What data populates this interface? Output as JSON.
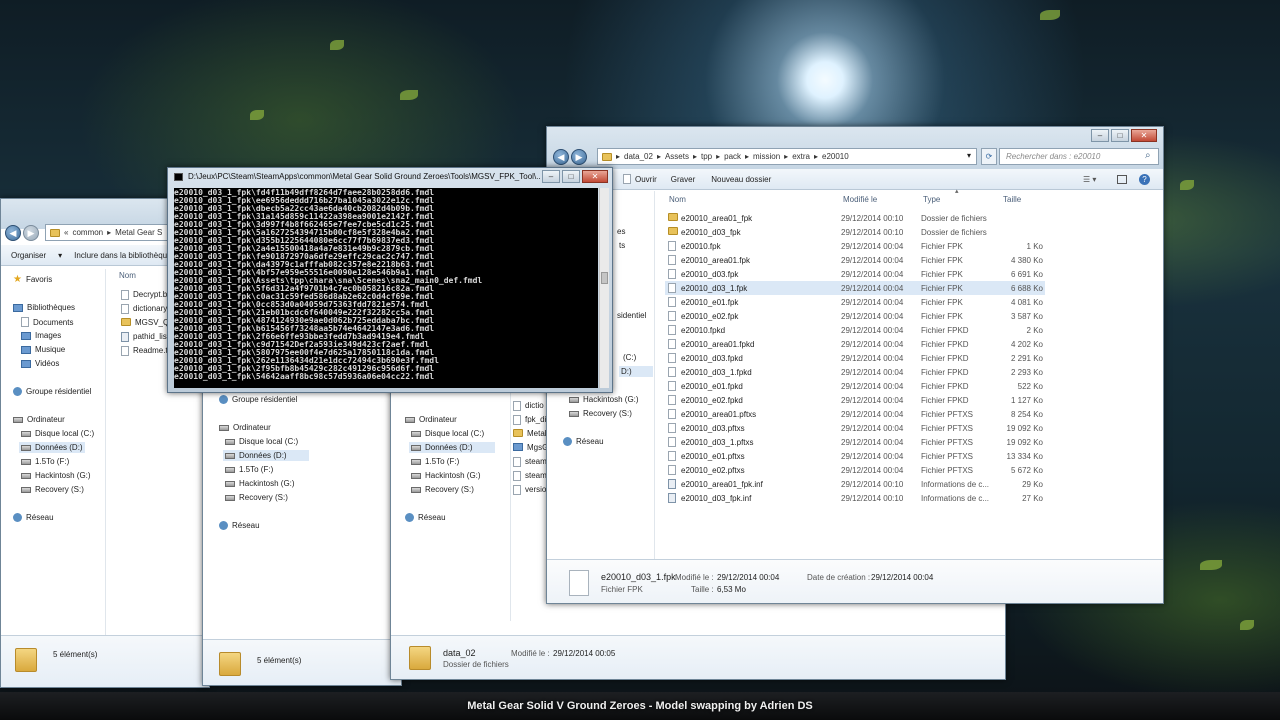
{
  "video_caption": "Metal Gear Solid V Ground Zeroes - Model swapping by Adrien DS",
  "window_back": {
    "address": [
      "common",
      "Metal Gear S"
    ],
    "cmd": {
      "organize": "Organiser",
      "include": "Inclure dans la bibliothèque"
    },
    "sidebar": [
      {
        "label": "Favoris",
        "icon": "star-icon"
      },
      {
        "label": "Bibliothèques",
        "icon": "library-icon"
      },
      {
        "label": "Documents",
        "icon": "documents-icon"
      },
      {
        "label": "Images",
        "icon": "images-icon"
      },
      {
        "label": "Musique",
        "icon": "music-icon"
      },
      {
        "label": "Vidéos",
        "icon": "videos-icon"
      },
      {
        "label": "Groupe résidentiel",
        "icon": "homegroup-icon"
      },
      {
        "label": "Ordinateur",
        "icon": "computer-icon"
      },
      {
        "label": "Disque local (C:)",
        "icon": "drive-icon"
      },
      {
        "label": "Données (D:)",
        "icon": "drive-icon"
      },
      {
        "label": "1.5To (F:)",
        "icon": "drive-icon"
      },
      {
        "label": "Hackintosh (G:)",
        "icon": "drive-icon"
      },
      {
        "label": "Recovery (S:)",
        "icon": "drive-icon"
      },
      {
        "label": "Réseau",
        "icon": "network-icon"
      }
    ],
    "col_name": "Nom",
    "files": [
      "Decrypt.b",
      "dictionary",
      "MGSV_QA",
      "pathid_list",
      "Readme.t"
    ],
    "status": "5 élément(s)"
  },
  "window_mid": {
    "sidebar": [
      {
        "label": "Groupe résidentiel"
      },
      {
        "label": "Ordinateur"
      },
      {
        "label": "Disque local (C:)"
      },
      {
        "label": "Données (D:)"
      },
      {
        "label": "1.5To (F:)"
      },
      {
        "label": "Hackintosh (G:)"
      },
      {
        "label": "Recovery (S:)"
      },
      {
        "label": "Réseau"
      }
    ],
    "status": "5 élément(s)"
  },
  "window_mid2": {
    "sidebar": [
      {
        "label": "Ordinateur"
      },
      {
        "label": "Disque local (C:)"
      },
      {
        "label": "Données (D:)"
      },
      {
        "label": "1.5To (F:)"
      },
      {
        "label": "Hackintosh (G:)"
      },
      {
        "label": "Recovery (S:)"
      },
      {
        "label": "Réseau"
      }
    ],
    "files": [
      "dictio",
      "fpk_di",
      "Metal",
      "MgsG",
      "steam",
      "steam",
      "versio"
    ],
    "details": {
      "name": "data_02",
      "modified_label": "Modifié le :",
      "modified": "29/12/2014 00:05",
      "type": "Dossier de fichiers"
    }
  },
  "console": {
    "title": "D:\\Jeux\\PC\\Steam\\SteamApps\\common\\Metal Gear Solid Ground Zeroes\\Tools\\MGSV_FPK_Tool\\...",
    "lines": [
      "e20010_d03_1_fpk\\fd4f11b49dff8264d7faee28b0258dd6.fmdl",
      "e20010_d03_1_fpk\\ee6956deddd716b27ba1045a3022e12c.fmdl",
      "e20010_d03_1_fpk\\dbecb5a22cc43ae6da40cb2082d4b09b.fmdl",
      "e20010_d03_1_fpk\\31a145d859c11422a398ea9001e2142f.fmdl",
      "e20010_d03_1_fpk\\3d997f4b8f662465e7fee7cbe5cd1c25.fmdl",
      "e20010_d03_1_fpk\\5a1627254394715b00cf8e5f328e4ba2.fmdl",
      "e20010_d03_1_fpk\\d355b1225644080e6cc77f7b69837ed3.fmdl",
      "e20010_d03_1_fpk\\2a4e15500418a4a7e831e49b9c2879cb.fmdl",
      "e20010_d03_1_fpk\\fe901872970a6dfe29effc29cac2c747.fmdl",
      "e20010_d03_1_fpk\\da43979c1afffab082c357e8e2218b63.fmdl",
      "e20010_d03_1_fpk\\4bf57e959e55516e0090e128e546b9a1.fmdl",
      "e20010_d03_1_fpk\\Assets\\tpp\\chara\\sna\\Scenes\\sna2_main0_def.fmdl",
      "e20010_d03_1_fpk\\5f6d312a4f9701b4c7ec0b058216c82a.fmdl",
      "e20010_d03_1_fpk\\c0ac31c59fed586d8ab2e62c0d4cf69e.fmdl",
      "e20010_d03_1_fpk\\0cc853d0a04059d75363fdd7821e574.fmdl",
      "e20010_d03_1_fpk\\21eb01bcdc6f640049e222f32282cc5a.fmdl",
      "e20010_d03_1_fpk\\4874124930e9ae0d062b725eddaba7bc.fmdl",
      "e20010_d03_1_fpk\\b615456f73248aa5b74e4642147e3ad6.fmdl",
      "e20010_d03_1_fpk\\2f66e6ffe93bbe3fedd7b3ad9419e4.fmdl",
      "e20010_d03_1_fpk\\c9d71542Def2a593ie349d423cf2aef.fmdl",
      "e20010_d03_1_fpk\\5807975ee00f4e7d625a17850118c1da.fmdl",
      "e20010_d03_1_fpk\\262e1136434d21e1dcc72494c3b690e3f.fmdl",
      "e20010_d03_1_fpk\\2f95bfb8b45429c282c491296c956d6f.fmdl",
      "e20010_d03_1_fpk\\54642aaff8bc98c57d5936a06e04cc22.fmdl"
    ]
  },
  "window_front": {
    "address": [
      "data_02",
      "Assets",
      "tpp",
      "pack",
      "mission",
      "extra",
      "e20010"
    ],
    "search_placeholder": "Rechercher dans : e20010",
    "cmd": {
      "open": "Ouvrir",
      "burn": "Graver",
      "new_folder": "Nouveau dossier"
    },
    "columns": {
      "name": "Nom",
      "modified": "Modifié le",
      "type": "Type",
      "size": "Taille"
    },
    "files": [
      {
        "name": "e20010_area01_fpk",
        "date": "29/12/2014 00:10",
        "type": "Dossier de fichiers",
        "size": "",
        "icon": "folder-icon"
      },
      {
        "name": "e20010_d03_fpk",
        "date": "29/12/2014 00:10",
        "type": "Dossier de fichiers",
        "size": "",
        "icon": "folder-icon"
      },
      {
        "name": "e20010.fpk",
        "date": "29/12/2014 00:04",
        "type": "Fichier FPK",
        "size": "1 Ko",
        "icon": "file-icon"
      },
      {
        "name": "e20010_area01.fpk",
        "date": "29/12/2014 00:04",
        "type": "Fichier FPK",
        "size": "4 380 Ko",
        "icon": "file-icon"
      },
      {
        "name": "e20010_d03.fpk",
        "date": "29/12/2014 00:04",
        "type": "Fichier FPK",
        "size": "6 691 Ko",
        "icon": "file-icon"
      },
      {
        "name": "e20010_d03_1.fpk",
        "date": "29/12/2014 00:04",
        "type": "Fichier FPK",
        "size": "6 688 Ko",
        "icon": "file-icon",
        "selected": true
      },
      {
        "name": "e20010_e01.fpk",
        "date": "29/12/2014 00:04",
        "type": "Fichier FPK",
        "size": "4 081 Ko",
        "icon": "file-icon"
      },
      {
        "name": "e20010_e02.fpk",
        "date": "29/12/2014 00:04",
        "type": "Fichier FPK",
        "size": "3 587 Ko",
        "icon": "file-icon"
      },
      {
        "name": "e20010.fpkd",
        "date": "29/12/2014 00:04",
        "type": "Fichier FPKD",
        "size": "2 Ko",
        "icon": "file-icon"
      },
      {
        "name": "e20010_area01.fpkd",
        "date": "29/12/2014 00:04",
        "type": "Fichier FPKD",
        "size": "4 202 Ko",
        "icon": "file-icon"
      },
      {
        "name": "e20010_d03.fpkd",
        "date": "29/12/2014 00:04",
        "type": "Fichier FPKD",
        "size": "2 291 Ko",
        "icon": "file-icon"
      },
      {
        "name": "e20010_d03_1.fpkd",
        "date": "29/12/2014 00:04",
        "type": "Fichier FPKD",
        "size": "2 293 Ko",
        "icon": "file-icon"
      },
      {
        "name": "e20010_e01.fpkd",
        "date": "29/12/2014 00:04",
        "type": "Fichier FPKD",
        "size": "522 Ko",
        "icon": "file-icon"
      },
      {
        "name": "e20010_e02.fpkd",
        "date": "29/12/2014 00:04",
        "type": "Fichier FPKD",
        "size": "1 127 Ko",
        "icon": "file-icon"
      },
      {
        "name": "e20010_area01.pftxs",
        "date": "29/12/2014 00:04",
        "type": "Fichier PFTXS",
        "size": "8 254 Ko",
        "icon": "file-icon"
      },
      {
        "name": "e20010_d03.pftxs",
        "date": "29/12/2014 00:04",
        "type": "Fichier PFTXS",
        "size": "19 092 Ko",
        "icon": "file-icon"
      },
      {
        "name": "e20010_d03_1.pftxs",
        "date": "29/12/2014 00:04",
        "type": "Fichier PFTXS",
        "size": "19 092 Ko",
        "icon": "file-icon"
      },
      {
        "name": "e20010_e01.pftxs",
        "date": "29/12/2014 00:04",
        "type": "Fichier PFTXS",
        "size": "13 334 Ko",
        "icon": "file-icon"
      },
      {
        "name": "e20010_e02.pftxs",
        "date": "29/12/2014 00:04",
        "type": "Fichier PFTXS",
        "size": "5 672 Ko",
        "icon": "file-icon"
      },
      {
        "name": "e20010_area01_fpk.inf",
        "date": "29/12/2014 00:10",
        "type": "Informations de c...",
        "size": "29 Ko",
        "icon": "info-file-icon"
      },
      {
        "name": "e20010_d03_fpk.inf",
        "date": "29/12/2014 00:10",
        "type": "Informations de c...",
        "size": "27 Ko",
        "icon": "info-file-icon"
      }
    ],
    "sidebar_partial": [
      "es",
      "ts",
      "sidentiel",
      "(C:)",
      "D:)",
      "Hackintosh (G:)",
      "Recovery (S:)",
      "Réseau"
    ],
    "details": {
      "name": "e20010_d03_1.fpk",
      "type": "Fichier FPK",
      "modified_label": "Modifié le :",
      "modified": "29/12/2014 00:04",
      "created_label": "Date de création :",
      "created": "29/12/2014 00:04",
      "size_label": "Taille :",
      "size": "6,53 Mo"
    }
  }
}
